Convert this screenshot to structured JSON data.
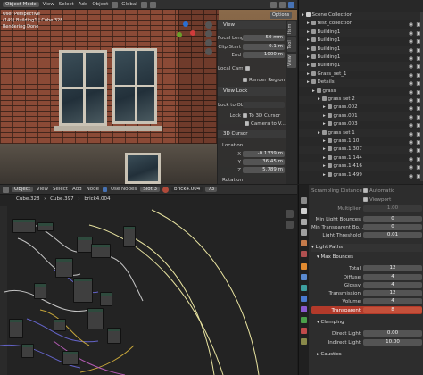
{
  "viewport": {
    "header": {
      "mode": "Object Mode",
      "menus": [
        "View",
        "Select",
        "Add",
        "Object"
      ],
      "orientation": "Global",
      "options": "Options"
    },
    "overlay": {
      "line1": "User Perspective",
      "line2": "(149) Building1 | Cube.328",
      "line3": "Rendering Done"
    },
    "npanel": {
      "view_title": "View",
      "focal_label": "Focal Lenge",
      "focal_value": "50 mm",
      "clip_start_label": "Clip Start",
      "clip_start_value": "0.1 m",
      "end_label": "End",
      "end_value": "1000 m",
      "local_cam_label": "Local Cam...",
      "render_region": "Render Region",
      "view_lock_title": "View Lock",
      "lock_to_obj": "Lock to Ob...",
      "lock_label": "Lock",
      "to_3d_cursor": "To 3D Cursor",
      "camera_to_v": "Camera to V...",
      "cursor_title": "3D Cursor",
      "location": "Location",
      "x_label": "X",
      "x_value": "-0.1339 m",
      "y_label": "Y",
      "y_value": "36.45 m",
      "z_label": "Z",
      "z_value": "5.789 m",
      "rotation": "Rotation"
    },
    "tabs": [
      "Item",
      "Tool",
      "View"
    ]
  },
  "outliner": {
    "rows": [
      {
        "label": "Scene Collection",
        "indent": 0
      },
      {
        "label": "test_collection",
        "indent": 1
      },
      {
        "label": "Building1",
        "indent": 1
      },
      {
        "label": "Building1",
        "indent": 1
      },
      {
        "label": "Building1",
        "indent": 1
      },
      {
        "label": "Building1",
        "indent": 1
      },
      {
        "label": "Building1",
        "indent": 1
      },
      {
        "label": "Grass_set_1",
        "indent": 1
      },
      {
        "label": "Details",
        "indent": 1
      },
      {
        "label": "grass",
        "indent": 2
      },
      {
        "label": "grass set 2",
        "indent": 3
      },
      {
        "label": "grass.002",
        "indent": 4
      },
      {
        "label": "grass.001",
        "indent": 4
      },
      {
        "label": "grass.003",
        "indent": 4
      },
      {
        "label": "grass set 1",
        "indent": 3
      },
      {
        "label": "grass.1.10",
        "indent": 4
      },
      {
        "label": "grass.1.307",
        "indent": 4
      },
      {
        "label": "grass.1.144",
        "indent": 4
      },
      {
        "label": "grass.1.416",
        "indent": 4
      },
      {
        "label": "grass.1.499",
        "indent": 4
      }
    ]
  },
  "node_editor": {
    "header": {
      "type": "Object",
      "menus": [
        "View",
        "Select",
        "Add",
        "Node"
      ],
      "use_nodes": "Use Nodes",
      "slot": "Slot 3",
      "material": "brick4.004",
      "users": "73"
    },
    "breadcrumb": [
      "Cube.328",
      "Cube.397",
      "brick4.004"
    ]
  },
  "properties": {
    "top": {
      "scrambling": "Scrambling Distance",
      "automatic": "Automatic",
      "viewport": "Viewport",
      "multiplier": "Multiplier",
      "multiplier_value": "1.00"
    },
    "rows": [
      {
        "label": "Min Light Bounces",
        "value": "0"
      },
      {
        "label": "Min Transparent Bo...",
        "value": "0"
      },
      {
        "label": "Light Threshold",
        "value": "0.01"
      }
    ],
    "light_paths": "Light Paths",
    "max_bounces": "Max Bounces",
    "bounces": [
      {
        "label": "Total",
        "value": "12"
      },
      {
        "label": "Diffuse",
        "value": "4"
      },
      {
        "label": "Glossy",
        "value": "4"
      },
      {
        "label": "Transmission",
        "value": "12"
      },
      {
        "label": "Volume",
        "value": "4"
      },
      {
        "label": "Transparent",
        "value": "8"
      }
    ],
    "clamping": "Clamping",
    "direct_light_label": "Direct Light",
    "direct_light_value": "0.00",
    "indirect_light_label": "Indirect Light",
    "indirect_light_value": "10.00",
    "caustics": "Caustics"
  },
  "colors": {
    "accent": "#4772b3",
    "highlight": "#b33a2a",
    "node_header": "#2e4a3d"
  }
}
